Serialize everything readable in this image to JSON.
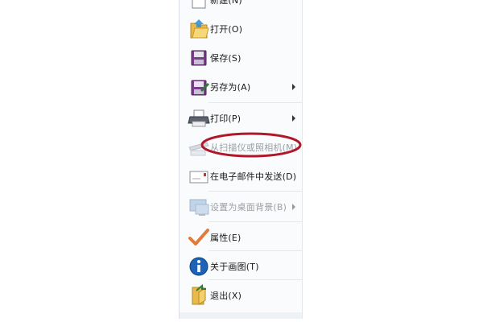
{
  "menu": {
    "items": [
      {
        "label": "新建(N)",
        "icon": "new-document-icon",
        "disabled": false,
        "submenu": false
      },
      {
        "label": "打开(O)",
        "icon": "folder-open-icon",
        "disabled": false,
        "submenu": false
      },
      {
        "label": "保存(S)",
        "icon": "floppy-disk-icon",
        "disabled": false,
        "submenu": false
      },
      {
        "label": "另存为(A)",
        "icon": "save-as-icon",
        "disabled": false,
        "submenu": true
      },
      {
        "label": "打印(P)",
        "icon": "printer-icon",
        "disabled": false,
        "submenu": true
      },
      {
        "label": "从扫描仪或照相机(M)",
        "icon": "scanner-icon",
        "disabled": true,
        "submenu": false
      },
      {
        "label": "在电子邮件中发送(D)",
        "icon": "email-icon",
        "disabled": false,
        "submenu": false
      },
      {
        "label": "设置为桌面背景(B)",
        "icon": "desktop-background-icon",
        "disabled": true,
        "submenu": true
      },
      {
        "label": "属性(E)",
        "icon": "checkmark-icon",
        "disabled": false,
        "submenu": false
      },
      {
        "label": "关于画图(T)",
        "icon": "info-icon",
        "disabled": false,
        "submenu": false
      },
      {
        "label": "退出(X)",
        "icon": "exit-icon",
        "disabled": false,
        "submenu": false
      }
    ]
  },
  "annotation": {
    "shape": "ellipse",
    "color": "#b0182a",
    "target": "从扫描仪或照相机(M)"
  },
  "colors": {
    "menu_bg": "#fafbfd",
    "disabled_text": "#9aa0a6",
    "annotation": "#b0182a"
  }
}
